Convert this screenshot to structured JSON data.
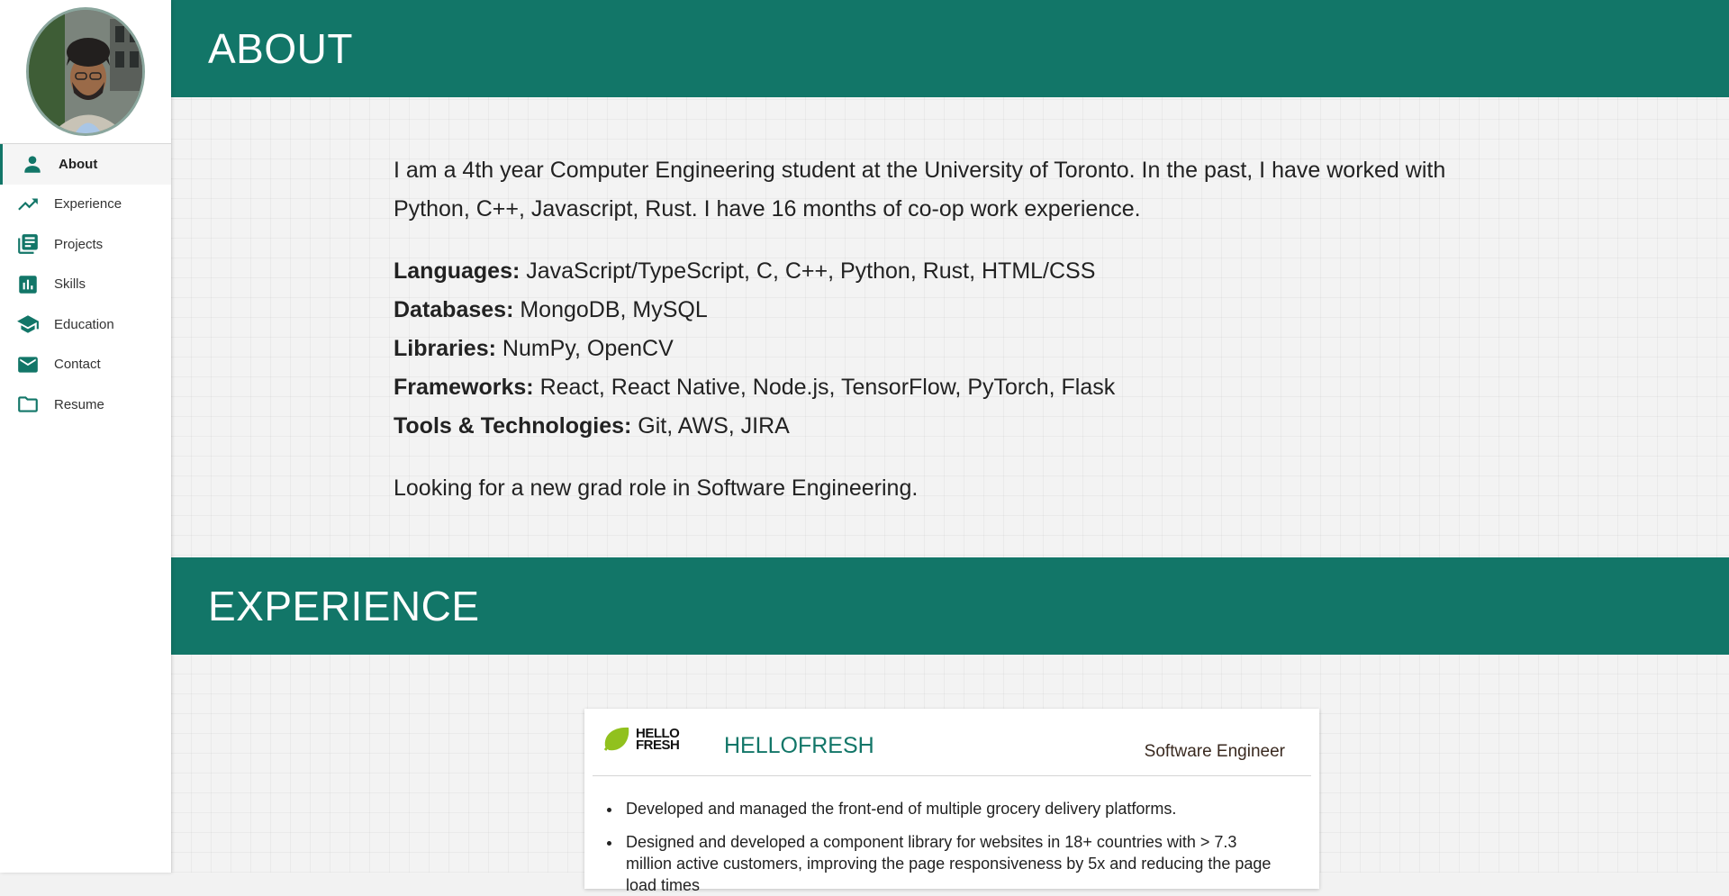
{
  "sidebar": {
    "items": [
      {
        "label": "About",
        "icon": "person-icon",
        "active": true
      },
      {
        "label": "Experience",
        "icon": "trending-up-icon"
      },
      {
        "label": "Projects",
        "icon": "library-books-icon"
      },
      {
        "label": "Skills",
        "icon": "bar-chart-icon"
      },
      {
        "label": "Education",
        "icon": "school-icon"
      },
      {
        "label": "Contact",
        "icon": "mail-icon"
      },
      {
        "label": "Resume",
        "icon": "folder-icon"
      }
    ]
  },
  "about": {
    "title": "ABOUT",
    "intro": "I am a 4th year Computer Engineering student at the University of Toronto. In the past, I have worked with Python, C++, Javascript, Rust. I have 16 months of co-op work experience.",
    "skills": [
      {
        "label": "Languages:",
        "value": " JavaScript/TypeScript, C, C++, Python, Rust, HTML/CSS"
      },
      {
        "label": "Databases:",
        "value": " MongoDB, MySQL"
      },
      {
        "label": "Libraries:",
        "value": " NumPy, OpenCV"
      },
      {
        "label": "Frameworks:",
        "value": " React, React Native, Node.js, TensorFlow, PyTorch, Flask"
      },
      {
        "label": "Tools & Technologies:",
        "value": " Git, AWS, JIRA"
      }
    ],
    "looking": "Looking for a new grad role in Software Engineering."
  },
  "experience": {
    "title": "EXPERIENCE",
    "jobs": [
      {
        "logo_text_line1": "HELLO",
        "logo_text_line2": "FRESH",
        "company": "HELLOFRESH",
        "role": "Software Engineer",
        "bullets": [
          "Developed and managed the front-end of multiple grocery delivery platforms.",
          "Designed and developed a component library for websites in 18+ countries with > 7.3 million active customers, improving the page responsiveness by 5x and reducing the page load times"
        ]
      }
    ]
  },
  "colors": {
    "accent": "#127668",
    "logo_green": "#91C11E"
  }
}
